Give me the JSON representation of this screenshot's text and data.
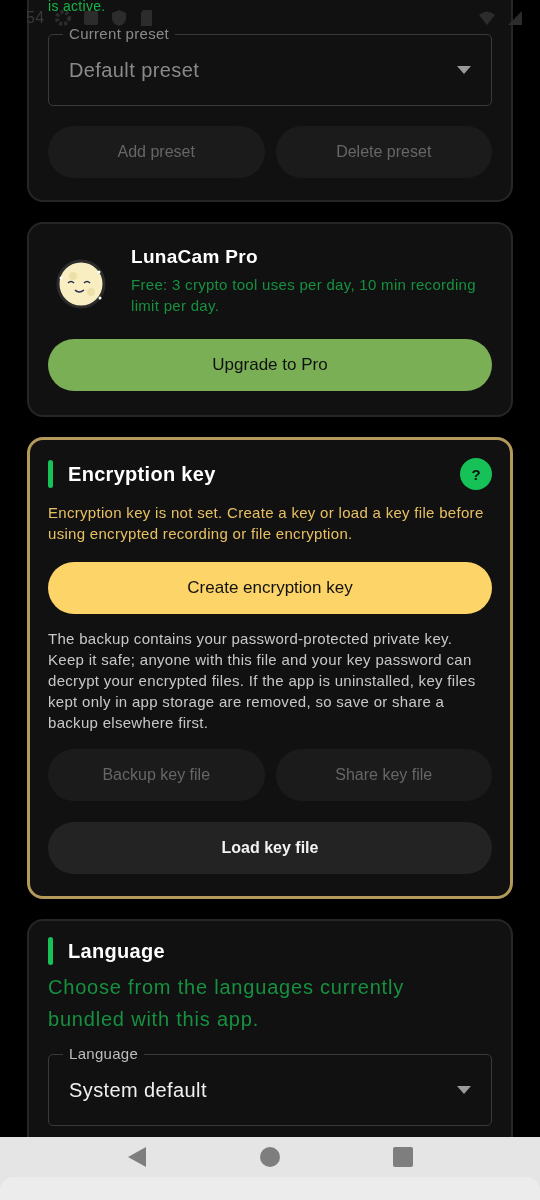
{
  "status_bar": {
    "time": "54"
  },
  "preset_card": {
    "note": "is active.",
    "field": {
      "label": "Current preset",
      "value": "Default preset"
    },
    "buttons": [
      {
        "label": "Add preset",
        "disabled": true
      },
      {
        "label": "Delete preset",
        "disabled": true
      }
    ]
  },
  "pro_card": {
    "title": "LunaCam Pro",
    "description": "Free: 3 crypto tool uses per day, 10 min recording limit per day.",
    "button": "Upgrade to Pro"
  },
  "encryption_card": {
    "title": "Encryption key",
    "help": "?",
    "warning": "Encryption key is not set. Create a key or load a key file before using encrypted recording or file encryption.",
    "primary_button": "Create encryption key",
    "info": "The backup contains your password-protected private key. Keep it safe; anyone with this file and your key password can decrypt your encrypted files. If the app is uninstalled, key files kept only in app storage are removed, so save or share a backup elsewhere first.",
    "buttons": [
      {
        "label": "Backup key file",
        "disabled": true
      },
      {
        "label": "Share key file",
        "disabled": true
      }
    ],
    "wide_button": {
      "label": "Load key file",
      "disabled": false
    }
  },
  "language_card": {
    "title": "Language",
    "description": "Choose from the languages currently bundled with this app.",
    "field": {
      "label": "Language",
      "value": "System default"
    }
  }
}
